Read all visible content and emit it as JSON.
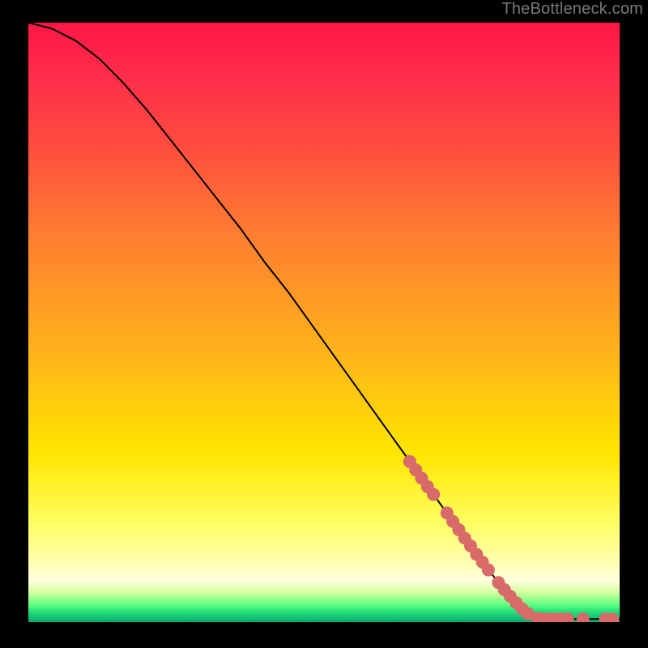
{
  "watermark": "TheBottleneck.com",
  "chart_data": {
    "type": "line",
    "title": "",
    "xlabel": "",
    "ylabel": "",
    "xlim": [
      0,
      100
    ],
    "ylim": [
      0,
      100
    ],
    "grid": false,
    "legend": false,
    "curve_points": [
      {
        "x": 0,
        "y": 100
      },
      {
        "x": 4,
        "y": 99
      },
      {
        "x": 8,
        "y": 97
      },
      {
        "x": 12,
        "y": 94
      },
      {
        "x": 16,
        "y": 90
      },
      {
        "x": 20,
        "y": 85.5
      },
      {
        "x": 24,
        "y": 80.5
      },
      {
        "x": 28,
        "y": 75.5
      },
      {
        "x": 32,
        "y": 70.5
      },
      {
        "x": 36,
        "y": 65.5
      },
      {
        "x": 40,
        "y": 60
      },
      {
        "x": 44,
        "y": 55
      },
      {
        "x": 48,
        "y": 49.5
      },
      {
        "x": 52,
        "y": 44
      },
      {
        "x": 56,
        "y": 38.5
      },
      {
        "x": 60,
        "y": 33
      },
      {
        "x": 64,
        "y": 27.5
      },
      {
        "x": 68,
        "y": 22
      },
      {
        "x": 72,
        "y": 16.5
      },
      {
        "x": 76,
        "y": 11
      },
      {
        "x": 80,
        "y": 6
      },
      {
        "x": 83,
        "y": 2.5
      },
      {
        "x": 85,
        "y": 0.8
      },
      {
        "x": 88,
        "y": 0.5
      },
      {
        "x": 92,
        "y": 0.5
      },
      {
        "x": 96,
        "y": 0.5
      },
      {
        "x": 100,
        "y": 0.5
      }
    ],
    "marker_points": [
      {
        "x": 64.5,
        "y": 26.8
      },
      {
        "x": 65.5,
        "y": 25.4
      },
      {
        "x": 66.5,
        "y": 24.0
      },
      {
        "x": 67.5,
        "y": 22.6
      },
      {
        "x": 68.5,
        "y": 21.3
      },
      {
        "x": 70.8,
        "y": 18.2
      },
      {
        "x": 71.8,
        "y": 16.8
      },
      {
        "x": 72.8,
        "y": 15.4
      },
      {
        "x": 73.8,
        "y": 14.0
      },
      {
        "x": 74.8,
        "y": 12.7
      },
      {
        "x": 75.8,
        "y": 11.3
      },
      {
        "x": 76.8,
        "y": 10.0
      },
      {
        "x": 77.8,
        "y": 8.7
      },
      {
        "x": 79.5,
        "y": 6.6
      },
      {
        "x": 80.5,
        "y": 5.4
      },
      {
        "x": 81.5,
        "y": 4.3
      },
      {
        "x": 82.5,
        "y": 3.2
      },
      {
        "x": 83.5,
        "y": 2.2
      },
      {
        "x": 84.5,
        "y": 1.4
      },
      {
        "x": 86.2,
        "y": 0.6
      },
      {
        "x": 87.2,
        "y": 0.5
      },
      {
        "x": 88.2,
        "y": 0.5
      },
      {
        "x": 89.2,
        "y": 0.5
      },
      {
        "x": 90.2,
        "y": 0.5
      },
      {
        "x": 91.2,
        "y": 0.5
      },
      {
        "x": 93.8,
        "y": 0.5
      },
      {
        "x": 97.6,
        "y": 0.5
      },
      {
        "x": 98.8,
        "y": 0.5
      }
    ],
    "marker_color": "#d86a6a",
    "marker_radius": 8
  }
}
